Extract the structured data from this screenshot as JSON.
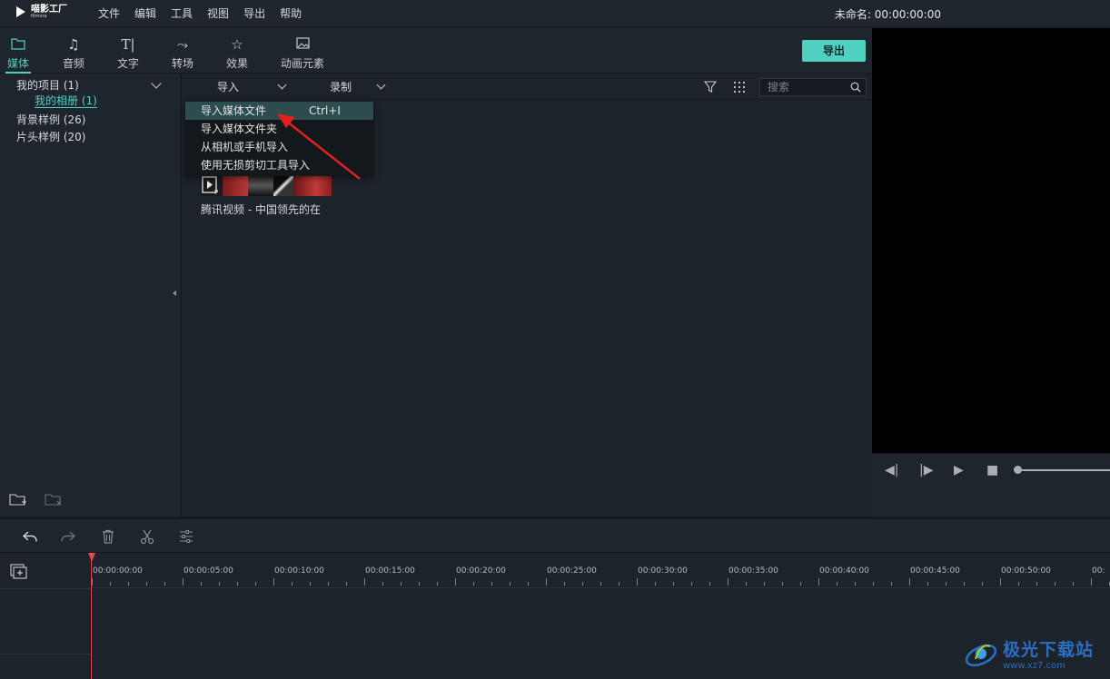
{
  "app": {
    "logo_name": "喵影工厂",
    "logo_sub": "filmora",
    "menu": [
      "文件",
      "编辑",
      "工具",
      "视图",
      "导出",
      "帮助"
    ],
    "project_title": "未命名: 00:00:00:00"
  },
  "tabs": [
    {
      "label": "媒体",
      "icon": "folder-icon",
      "active": true
    },
    {
      "label": "音频",
      "icon": "music-note-icon",
      "active": false
    },
    {
      "label": "文字",
      "icon": "text-icon",
      "active": false
    },
    {
      "label": "转场",
      "icon": "transition-icon",
      "active": false
    },
    {
      "label": "效果",
      "icon": "effects-star-icon",
      "active": false
    },
    {
      "label": "动画元素",
      "icon": "image-icon",
      "active": false
    }
  ],
  "export_button": "导出",
  "left_panel": {
    "items": [
      {
        "label": "我的项目 (1)"
      },
      {
        "label": "我的相册 (1)"
      },
      {
        "label": "背景样例 (26)"
      },
      {
        "label": "片头样例 (20)"
      }
    ]
  },
  "media_toolbar": {
    "import_label": "导入",
    "record_label": "录制",
    "search_placeholder": "搜索"
  },
  "import_menu": {
    "items": [
      {
        "label": "导入媒体文件",
        "shortcut": "Ctrl+I",
        "highlighted": true
      },
      {
        "label": "导入媒体文件夹",
        "shortcut": "",
        "highlighted": false
      },
      {
        "label": "从相机或手机导入",
        "shortcut": "",
        "highlighted": false
      },
      {
        "label": "使用无损剪切工具导入",
        "shortcut": "",
        "highlighted": false
      }
    ]
  },
  "media_item": {
    "label": "腾讯视频 - 中国领先的在"
  },
  "timeline": {
    "timecodes": [
      "00:00:00:00",
      "00:00:05:00",
      "00:00:10:00",
      "00:00:15:00",
      "00:00:20:00",
      "00:00:25:00",
      "00:00:30:00",
      "00:00:35:00",
      "00:00:40:00",
      "00:00:45:00",
      "00:00:50:00",
      "00:"
    ]
  },
  "watermark": {
    "title": "极光下载站",
    "url": "www.xz7.com"
  },
  "colors": {
    "accent": "#4fd0c1",
    "background": "#1d232a",
    "playhead": "#e24c4c",
    "annotation_arrow": "#e02020"
  }
}
